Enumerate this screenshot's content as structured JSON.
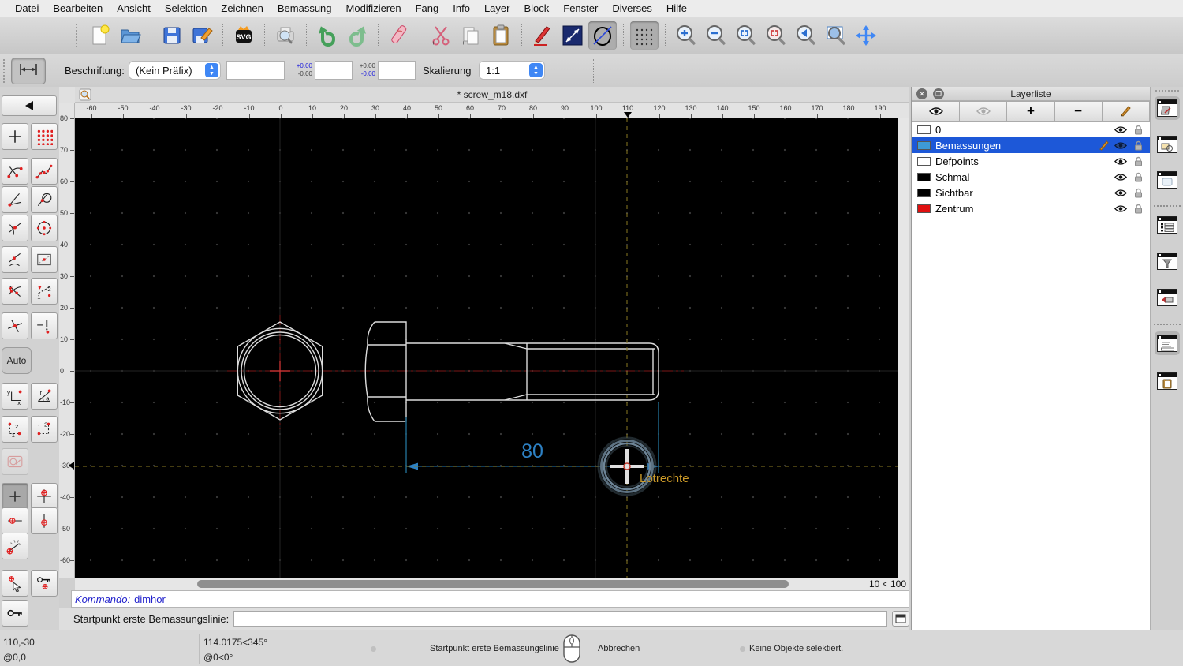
{
  "menu": {
    "items": [
      "Datei",
      "Bearbeiten",
      "Ansicht",
      "Selektion",
      "Zeichnen",
      "Bemassung",
      "Modifizieren",
      "Fang",
      "Info",
      "Layer",
      "Block",
      "Fenster",
      "Diverses",
      "Hilfe"
    ]
  },
  "toolbar1": {
    "icons": [
      "new-file-icon",
      "open-file-icon",
      "save-icon",
      "save-as-icon",
      "svg-export-icon",
      "print-preview-icon",
      "undo-icon",
      "redo-icon",
      "delete-icon",
      "cut-icon",
      "copy-icon",
      "paste-icon",
      "draw-point-icon",
      "draw-line-icon",
      "draw-ellipse-icon",
      "grid-toggle-icon",
      "zoom-in-icon",
      "zoom-out-icon",
      "auto-zoom-icon",
      "zoom-selection-icon",
      "previous-view-icon",
      "zoom-window-icon",
      "pan-icon"
    ]
  },
  "toolbar2": {
    "beschriftung_label": "Beschriftung:",
    "prefix_value": "(Kein Präfix)",
    "tol1_upper": "+0.00",
    "tol1_lower": "-0.00",
    "tol2_upper": "+0.00",
    "tol2_lower": "-0.00",
    "skalierung_label": "Skalierung",
    "scale_value": "1:1"
  },
  "document": {
    "title": "* screw_m18.dxf"
  },
  "rulers": {
    "horizontal_labels": [
      -60,
      -50,
      -40,
      -30,
      -20,
      -10,
      0,
      10,
      20,
      30,
      40,
      50,
      60,
      70,
      80,
      90,
      100,
      110,
      120,
      130,
      140,
      150,
      160,
      170,
      180,
      190
    ],
    "vertical_labels": [
      80,
      70,
      60,
      50,
      40,
      30,
      20,
      10,
      0,
      -10,
      -20,
      -30,
      -40,
      -50,
      -60
    ],
    "h_marker_value": 110,
    "v_marker_value": -30
  },
  "canvas": {
    "dimension_value": "80",
    "snap_tooltip": "Lotrechte",
    "grid_indicator": "10 < 100",
    "colors": {
      "dimension": "#2d81c4",
      "extension": "#1d6080",
      "crosshair": "#8a7a22",
      "centerline": "#7d1818",
      "outline": "#dcdcdc",
      "tooltip": "#cc9a28"
    }
  },
  "layer_panel": {
    "title": "Layerliste",
    "toolbar": [
      "show-all-layers",
      "hide-all-layers",
      "add-layer",
      "remove-layer",
      "edit-layer"
    ],
    "rows": [
      {
        "name": "0",
        "swatch": "#ffffff",
        "selected": false
      },
      {
        "name": "Bemassungen",
        "swatch": "#3d9ad6",
        "selected": true
      },
      {
        "name": "Defpoints",
        "swatch": "#ffffff",
        "selected": false
      },
      {
        "name": "Schmal",
        "swatch": "#000000",
        "selected": false
      },
      {
        "name": "Sichtbar",
        "swatch": "#000000",
        "selected": false
      },
      {
        "name": "Zentrum",
        "swatch": "#e01010",
        "selected": false
      }
    ]
  },
  "command": {
    "history_label": "Kommando:",
    "history_value": "dimhor",
    "prompt_label": "Startpunkt erste Bemassungslinie:",
    "input_value": ""
  },
  "left_toolbar": {
    "auto_label": "Auto"
  },
  "statusbar": {
    "coord_abs": "110,-30",
    "coord_rel": "@0,0",
    "polar_abs": "114.0175<345°",
    "polar_rel": "@0<0°",
    "left_click_hint": "Startpunkt erste Bemassungslinie",
    "right_click_hint": "Abbrechen",
    "selection_status": "Keine Objekte selektiert."
  }
}
